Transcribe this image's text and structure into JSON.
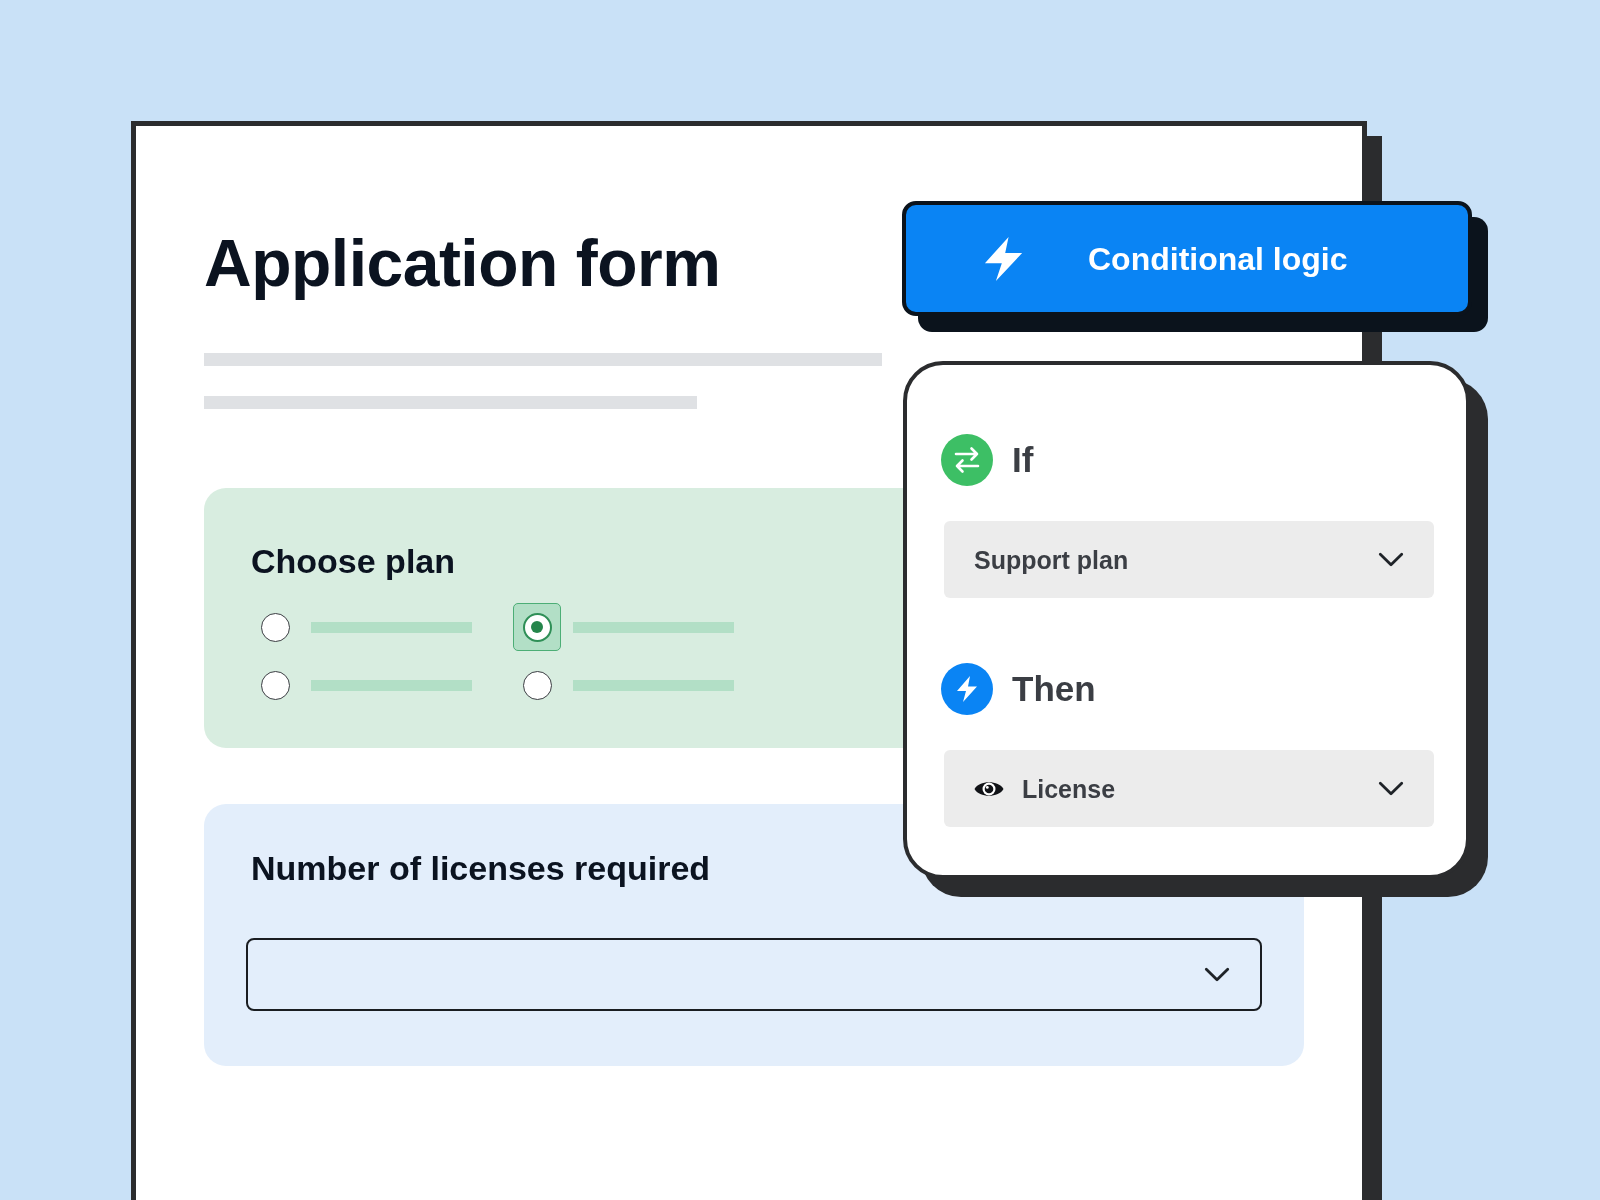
{
  "form": {
    "title": "Application form",
    "sections": [
      {
        "kind": "radio_group",
        "label": "Choose plan",
        "options": [
          {
            "selected": false
          },
          {
            "selected": true
          },
          {
            "selected": false
          },
          {
            "selected": false
          }
        ]
      },
      {
        "kind": "dropdown",
        "label": "Number of licenses required"
      }
    ]
  },
  "logic": {
    "title": "Conditional logic",
    "rules": [
      {
        "kind": "if",
        "label": "If",
        "value": "Support plan"
      },
      {
        "kind": "then",
        "label": "Then",
        "value": "License"
      }
    ]
  }
}
